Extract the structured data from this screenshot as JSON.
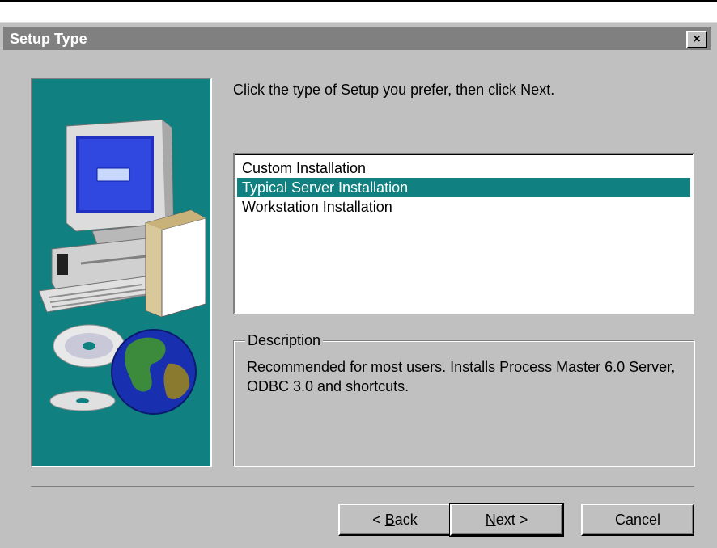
{
  "window": {
    "title": "Setup Type",
    "close_glyph": "×"
  },
  "instruction": "Click the type of Setup you prefer, then click Next.",
  "setup_types": {
    "items": [
      {
        "label": "Custom Installation"
      },
      {
        "label": "Typical Server Installation"
      },
      {
        "label": "Workstation Installation"
      }
    ],
    "selected_label": "Typical Server Installation"
  },
  "description": {
    "legend": "Description",
    "text": "Recommended for most users.  Installs Process Master 6.0 Server, ODBC 3.0 and shortcuts."
  },
  "buttons": {
    "back": {
      "prefix": "< ",
      "mnemonic": "B",
      "rest": "ack"
    },
    "next": {
      "mnemonic": "N",
      "rest": "ext >"
    },
    "cancel": "Cancel"
  },
  "colors": {
    "title_bar": "#808080",
    "selection": "#108080",
    "panel_background": "#108080",
    "dialog_face": "#c0c0c0"
  },
  "icons": {
    "art": [
      "computer-icon",
      "software-box-icon",
      "cd-disc-icon",
      "globe-icon"
    ]
  }
}
